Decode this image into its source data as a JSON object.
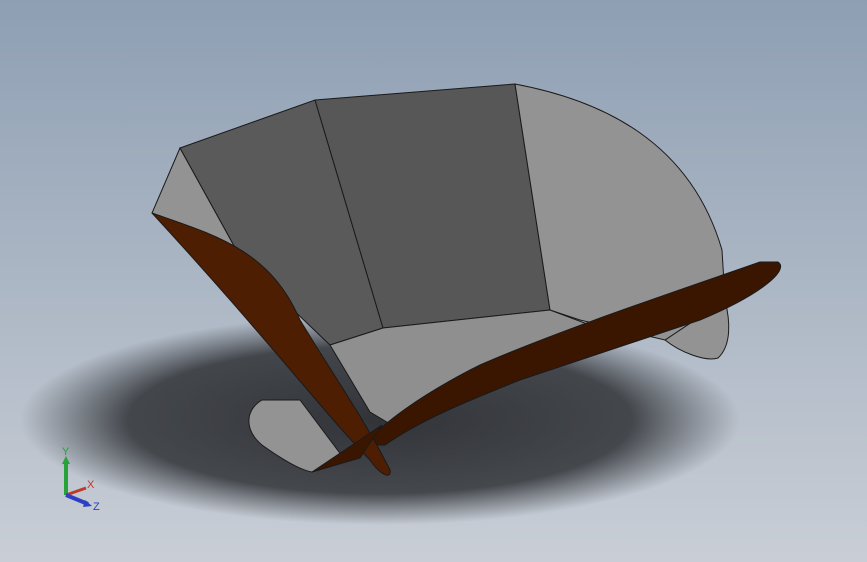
{
  "viewport": {
    "background_top": "#8e9fb3",
    "background_bottom": "#c9ced6"
  },
  "model": {
    "colors": {
      "light_face": "#939393",
      "mid_face": "#7a7a7a",
      "dark_face": "#575757",
      "fin_face": "#4e1e02",
      "fin_dark": "#3a1601",
      "edge": "#1a1a1a",
      "shadow": "#2a2c30"
    }
  },
  "triad": {
    "x_label": "X",
    "y_label": "Y",
    "z_label": "Z",
    "x_color": "#c0392b",
    "y_color": "#27a13a",
    "z_color": "#2c3fc4"
  }
}
